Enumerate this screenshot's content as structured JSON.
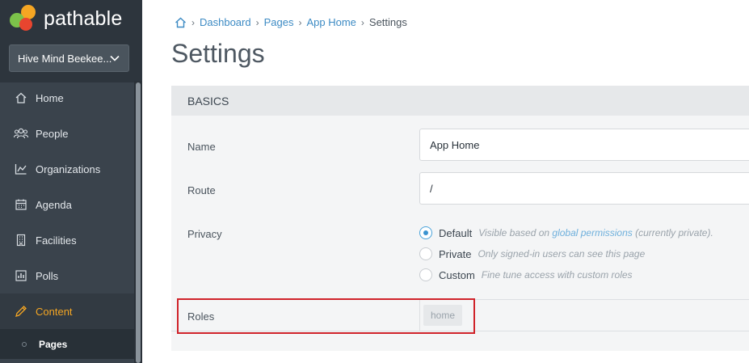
{
  "app": {
    "logo_text": "pathable",
    "org_name": "Hive Mind Beekee..."
  },
  "sidebar": {
    "items": [
      {
        "label": "Home",
        "icon": "home-icon"
      },
      {
        "label": "People",
        "icon": "people-icon"
      },
      {
        "label": "Organizations",
        "icon": "organizations-icon"
      },
      {
        "label": "Agenda",
        "icon": "calendar-icon"
      },
      {
        "label": "Facilities",
        "icon": "building-icon"
      },
      {
        "label": "Polls",
        "icon": "poll-icon"
      },
      {
        "label": "Content",
        "icon": "pencil-icon",
        "active": true
      }
    ],
    "sub_items": [
      {
        "label": "Pages"
      }
    ]
  },
  "breadcrumb": {
    "items": [
      "Dashboard",
      "Pages",
      "App Home"
    ],
    "current": "Settings"
  },
  "page": {
    "title": "Settings"
  },
  "basics": {
    "heading": "BASICS",
    "name_label": "Name",
    "name_value": "App Home",
    "route_label": "Route",
    "route_value": "/",
    "privacy_label": "Privacy",
    "privacy_options": [
      {
        "label": "Default",
        "desc_pre": "Visible based on ",
        "desc_link": "global permissions",
        "desc_post": " (currently private).",
        "checked": true
      },
      {
        "label": "Private",
        "desc": "Only signed-in users can see this page",
        "checked": false
      },
      {
        "label": "Custom",
        "desc": "Fine tune access with custom roles",
        "checked": false
      }
    ],
    "roles_label": "Roles",
    "roles_tag": "home"
  },
  "colors": {
    "accent": "#3d8bc4",
    "active_nav": "#f5a623",
    "highlight": "#d0232a",
    "sidebar_bg": "#3a434c"
  }
}
